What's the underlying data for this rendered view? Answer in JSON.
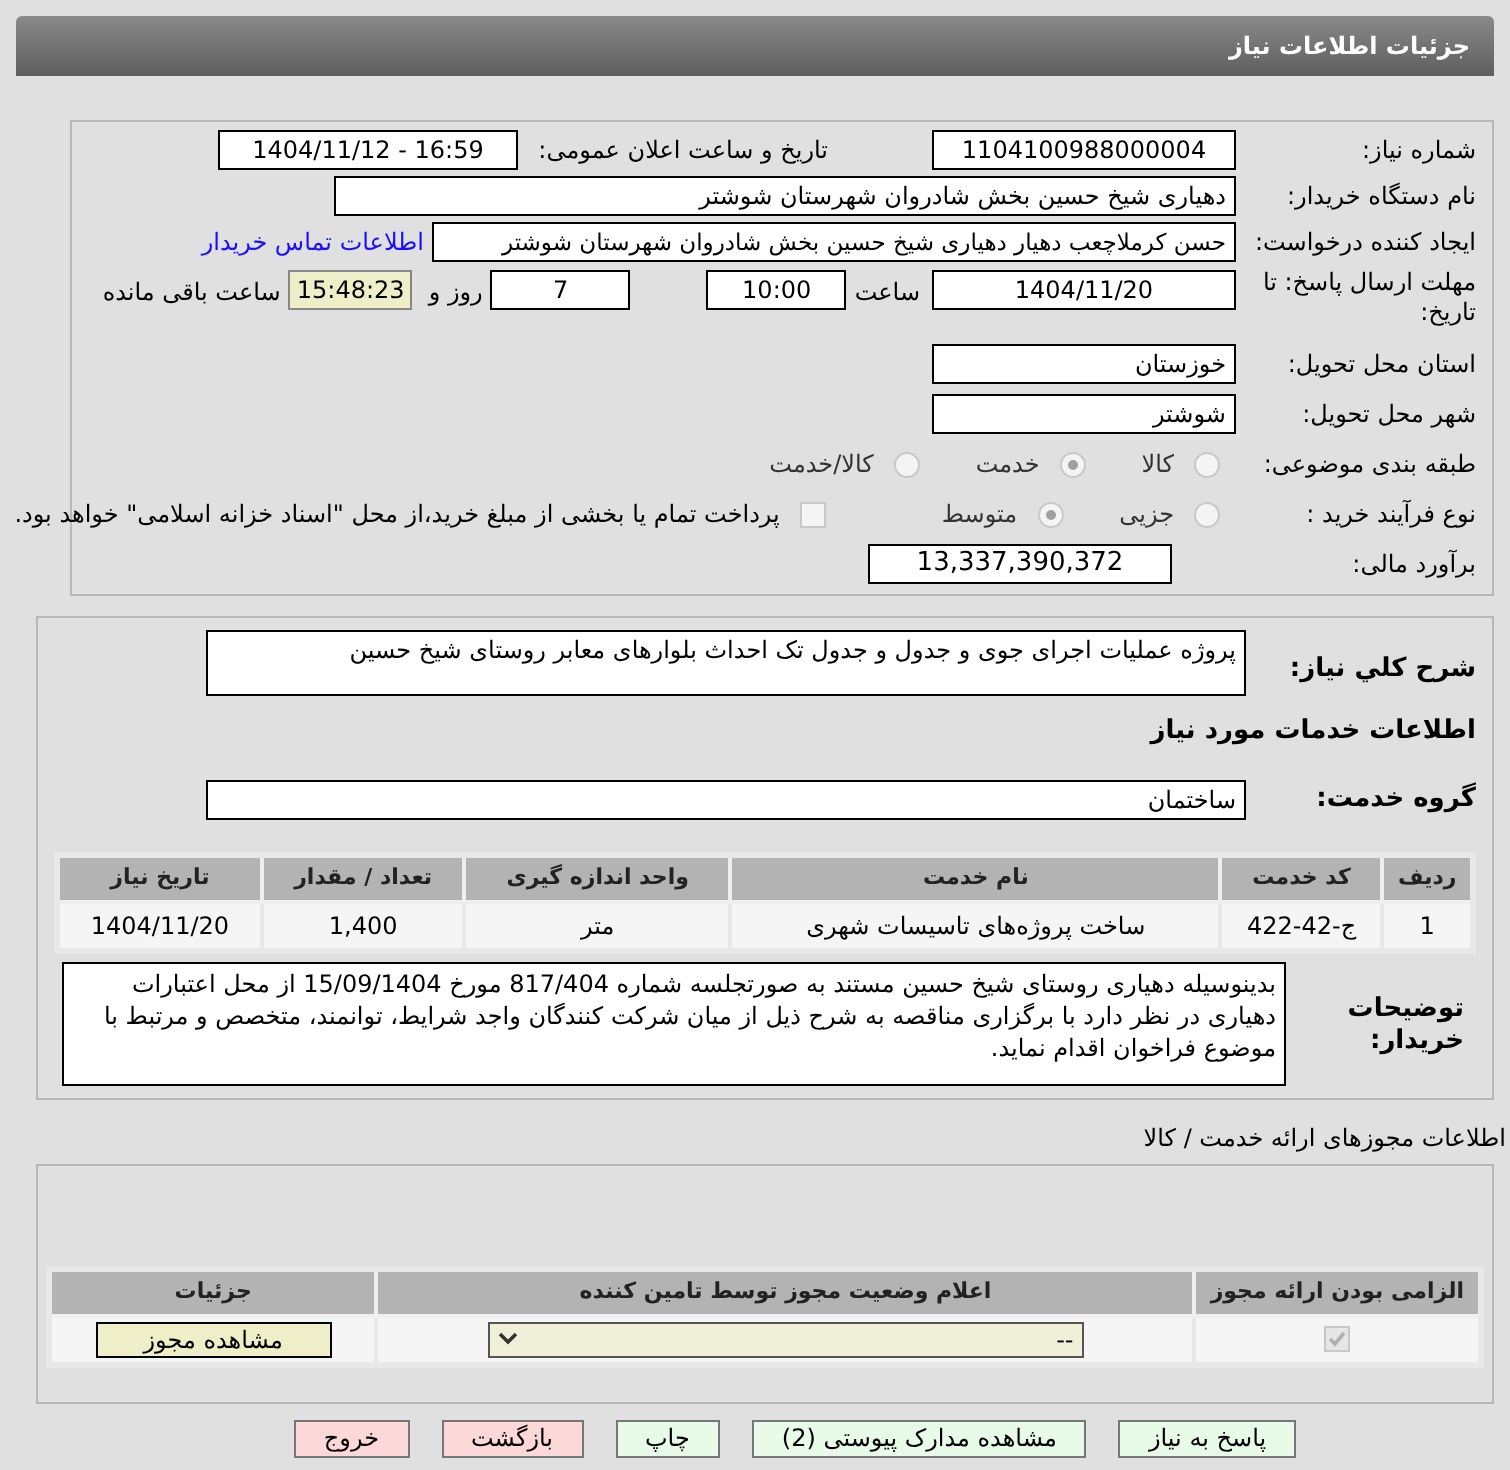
{
  "header": {
    "title": "جزئیات اطلاعات نیاز"
  },
  "need_number": {
    "label": "شماره نیاز:",
    "value": "1104100988000004"
  },
  "announce": {
    "label": "تاریخ و ساعت اعلان عمومی:",
    "value": "1404/11/12 - 16:59"
  },
  "buyer": {
    "label": "نام دستگاه خریدار:",
    "value": "دهیاری شیخ حسین بخش شادروان شهرستان شوشتر"
  },
  "creator": {
    "label": "ایجاد کننده درخواست:",
    "value": "حسن کرملاچعب دهیار دهیاری شیخ حسین بخش شادروان شهرستان شوشتر",
    "link": "اطلاعات تماس خریدار"
  },
  "deadline": {
    "label": "مهلت ارسال پاسخ: تا تاریخ:",
    "date": "1404/11/20",
    "time_label": "ساعت",
    "time": "10:00",
    "days": "7",
    "days_label": "روز و",
    "remaining": "15:48:23",
    "remaining_label": "ساعت باقی مانده"
  },
  "province": {
    "label": "استان محل تحویل:",
    "value": "خوزستان"
  },
  "city": {
    "label": "شهر محل تحویل:",
    "value": "شوشتر"
  },
  "category": {
    "label": "طبقه بندی موضوعی:",
    "options": [
      {
        "label": "کالا",
        "selected": false
      },
      {
        "label": "خدمت",
        "selected": true
      },
      {
        "label": "کالا/خدمت",
        "selected": false
      }
    ]
  },
  "process": {
    "label": "نوع فرآیند خرید :",
    "options": [
      {
        "label": "جزیی",
        "selected": false
      },
      {
        "label": "متوسط",
        "selected": true
      }
    ],
    "payment_checkbox": {
      "label": "پرداخت تمام یا بخشی از مبلغ خرید،از محل \"اسناد خزانه اسلامی\" خواهد بود.",
      "checked": false
    }
  },
  "budget": {
    "label": "برآورد مالی:",
    "value": "13,337,390,372"
  },
  "description": {
    "label": "شرح کلي نياز:",
    "value": "پروژه عملیات اجرای جوی و جدول و جدول تک احداث بلوارهای معابر روستای شیخ حسین"
  },
  "services_title": "اطلاعات خدمات مورد نیاز",
  "service_group": {
    "label": "گروه خدمت:",
    "value": "ساختمان"
  },
  "services_table": {
    "columns": [
      "ردیف",
      "کد خدمت",
      "نام خدمت",
      "واحد اندازه گیری",
      "تعداد / مقدار",
      "تاریخ نیاز"
    ],
    "rows": [
      [
        "1",
        "ج-42-422",
        "ساخت پروژه‌های تاسیسات شهری",
        "متر",
        "1,400",
        "1404/11/20"
      ]
    ]
  },
  "buyer_notes": {
    "label": "توضیحات خریدار:",
    "value": "بدینوسیله دهیاری روستای شیخ حسین مستند به صورتجلسه شماره 817/404 مورخ 15/09/1404 از محل اعتبارات دهیاری در نظر دارد با برگزاری مناقصه به شرح ذیل از میان شرکت کنندگان واجد شرایط، توانمند، متخصص و مرتبط با موضوع فراخوان اقدام نماید."
  },
  "permits": {
    "title": "اطلاعات مجوزهای ارائه خدمت / کالا",
    "columns": [
      "الزامی بودن ارائه مجوز",
      "اعلام وضعیت مجوز توسط تامین کننده",
      "جزئیات"
    ],
    "rows": [
      {
        "required": true,
        "status": "--",
        "details_button": "مشاهده مجوز"
      }
    ]
  },
  "buttons": [
    {
      "label": "پاسخ به نیاز",
      "kind": "normal"
    },
    {
      "label": "مشاهده مدارک پیوستی (2)",
      "kind": "normal"
    },
    {
      "label": "چاپ",
      "kind": "normal"
    },
    {
      "label": "بازگشت",
      "kind": "danger"
    },
    {
      "label": "خروج",
      "kind": "danger"
    }
  ]
}
